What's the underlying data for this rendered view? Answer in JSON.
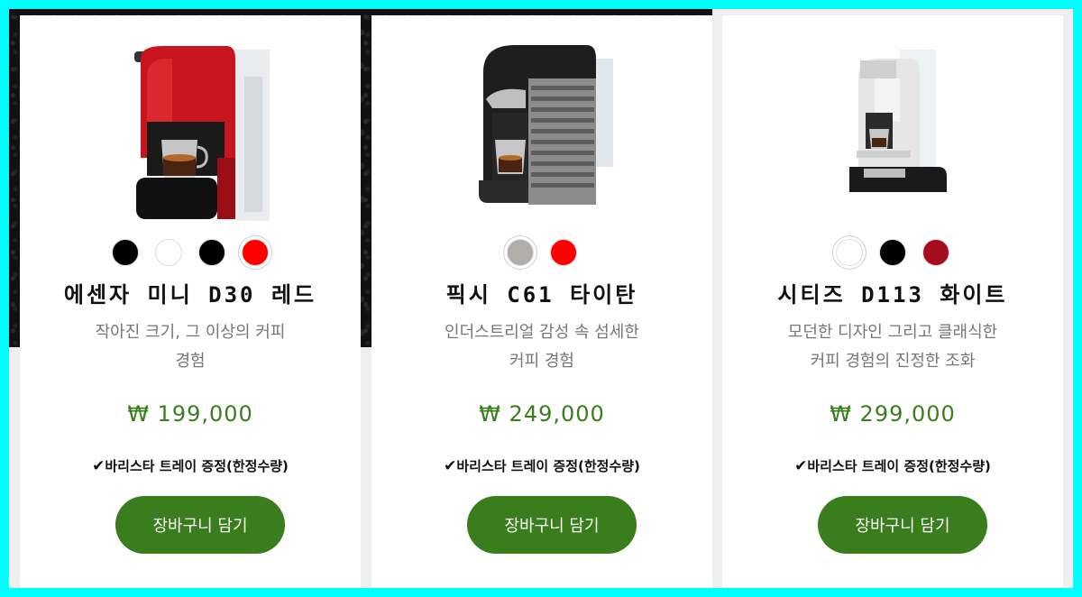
{
  "colors": {
    "accent": "#3a7d1c",
    "page_border": "#00ffff"
  },
  "products": [
    {
      "name": "에센자 미니 D30 레드",
      "description_line1": "작아진 크기, 그 이상의 커피",
      "description_line2": "경험",
      "price": "₩ 199,000",
      "promo": "바리스타 트레이 증정(한정수량)",
      "promo_mark": "✔",
      "cart_label": "장바구니 담기",
      "image_icon": "espresso-machine-red",
      "swatches": [
        {
          "color": "#000000",
          "selected": false
        },
        {
          "color": "#ffffff",
          "selected": false
        },
        {
          "color": "#000000",
          "selected": false
        },
        {
          "color": "#ff0000",
          "selected": true
        }
      ]
    },
    {
      "name": "픽시 C61 타이탄",
      "description_line1": "인더스트리얼 감성 속 섬세한",
      "description_line2": "커피 경험",
      "price": "₩ 249,000",
      "promo": "바리스타 트레이 증정(한정수량)",
      "promo_mark": "✔",
      "cart_label": "장바구니 담기",
      "image_icon": "espresso-machine-titan",
      "swatches": [
        {
          "color": "#b1ada9",
          "selected": true
        },
        {
          "color": "#ff0000",
          "selected": false
        }
      ]
    },
    {
      "name": "시티즈 D113 화이트",
      "description_line1": "모던한 디자인 그리고 클래식한",
      "description_line2": "커피 경험의 진정한 조화",
      "price": "₩ 299,000",
      "promo": "바리스타 트레이 증정(한정수량)",
      "promo_mark": "✔",
      "cart_label": "장바구니 담기",
      "image_icon": "espresso-machine-white",
      "swatches": [
        {
          "color": "#ffffff",
          "selected": true
        },
        {
          "color": "#000000",
          "selected": false
        },
        {
          "color": "#a50d1f",
          "selected": false
        }
      ]
    }
  ]
}
